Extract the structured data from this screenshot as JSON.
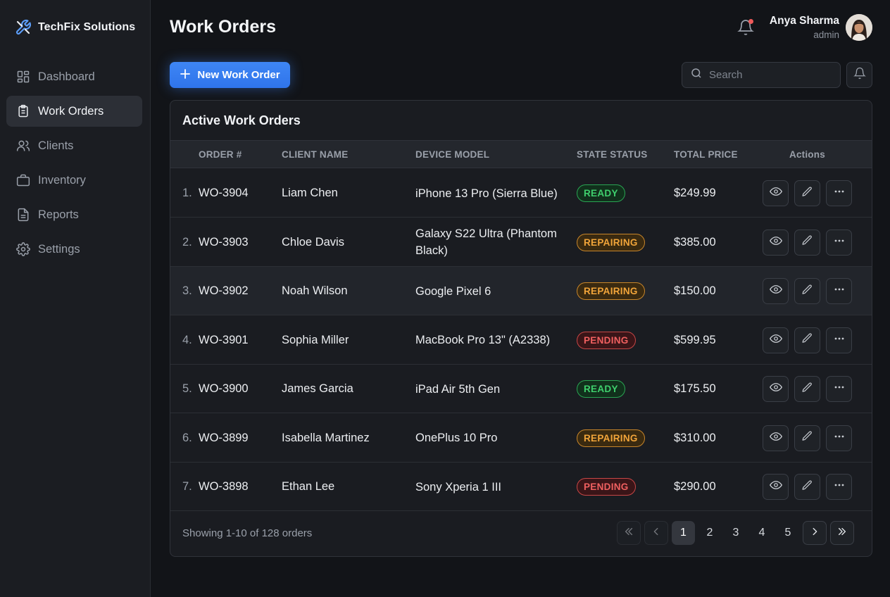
{
  "app": {
    "name": "TechFix Solutions"
  },
  "sidebar": {
    "items": [
      {
        "label": "Dashboard",
        "icon": "dashboard-icon",
        "active": false
      },
      {
        "label": "Work Orders",
        "icon": "clipboard-icon",
        "active": true
      },
      {
        "label": "Clients",
        "icon": "users-icon",
        "active": false
      },
      {
        "label": "Inventory",
        "icon": "briefcase-icon",
        "active": false
      },
      {
        "label": "Reports",
        "icon": "file-icon",
        "active": false
      },
      {
        "label": "Settings",
        "icon": "gear-icon",
        "active": false
      }
    ]
  },
  "header": {
    "title": "Work Orders",
    "user": {
      "name": "Anya Sharma",
      "role": "admin"
    },
    "notification_dot_color": "#ef5a5a"
  },
  "toolbar": {
    "new_button_label": "New Work Order",
    "search_placeholder": "Search"
  },
  "table": {
    "title": "Active Work Orders",
    "columns": [
      "ORDER #",
      "CLIENT NAME",
      "DEVICE MODEL",
      "STATE STATUS",
      "TOTAL PRICE",
      "Actions"
    ],
    "rows": [
      {
        "num": "1.",
        "order": "WO-3904",
        "client": "Liam Chen",
        "device": "iPhone 13 Pro (Sierra Blue)",
        "status": "READY",
        "price": "$249.99"
      },
      {
        "num": "2.",
        "order": "WO-3903",
        "client": "Chloe Davis",
        "device": "Galaxy S22 Ultra (Phantom Black)",
        "status": "REPAIRING",
        "price": "$385.00"
      },
      {
        "num": "3.",
        "order": "WO-3902",
        "client": "Noah Wilson",
        "device": "Google Pixel 6",
        "status": "REPAIRING",
        "price": "$150.00"
      },
      {
        "num": "4.",
        "order": "WO-3901",
        "client": "Sophia Miller",
        "device": "MacBook Pro 13\" (A2338)",
        "status": "PENDING",
        "price": "$599.95"
      },
      {
        "num": "5.",
        "order": "WO-3900",
        "client": "James Garcia",
        "device": "iPad Air 5th Gen",
        "status": "READY",
        "price": "$175.50"
      },
      {
        "num": "6.",
        "order": "WO-3899",
        "client": "Isabella Martinez",
        "device": "OnePlus 10 Pro",
        "status": "REPAIRING",
        "price": "$310.00"
      },
      {
        "num": "7.",
        "order": "WO-3898",
        "client": "Ethan Lee",
        "device": "Sony Xperia 1 III",
        "status": "PENDING",
        "price": "$290.00"
      }
    ],
    "highlighted_row": 3
  },
  "footer": {
    "showing_text": "Showing 1-10 of 128 orders",
    "pages": [
      "1",
      "2",
      "3",
      "4",
      "5"
    ],
    "current_page": "1"
  },
  "colors": {
    "accent": "#3b82f6",
    "ready": "#3fcf6d",
    "repairing": "#f2a53a",
    "pending": "#f06060"
  }
}
